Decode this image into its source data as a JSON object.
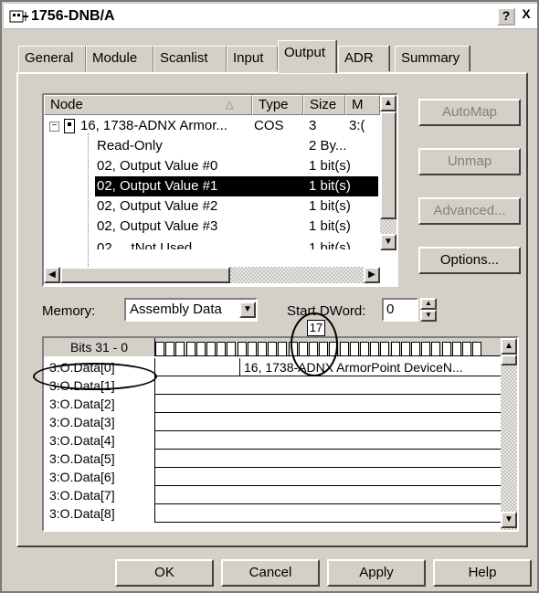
{
  "window": {
    "title": "1756-DNB/A",
    "help_label": "?",
    "close_label": "X"
  },
  "tabs": [
    {
      "label": "General"
    },
    {
      "label": "Module"
    },
    {
      "label": "Scanlist"
    },
    {
      "label": "Input"
    },
    {
      "label": "Output",
      "active": true
    },
    {
      "label": "ADR"
    },
    {
      "label": "Summary"
    }
  ],
  "tree": {
    "columns": {
      "node": "Node",
      "type": "Type",
      "size": "Size",
      "map": "M"
    },
    "rows": [
      {
        "node": "16, 1738-ADNX Armor...",
        "type": "COS",
        "size": "3",
        "map": "3:("
      },
      {
        "node": "Read-Only",
        "type": "",
        "size": "2 By...",
        "map": ""
      },
      {
        "node": "02, Output Value #0",
        "type": "",
        "size": "1 bit(s)",
        "map": ""
      },
      {
        "node": "02, Output Value #1",
        "type": "",
        "size": "1 bit(s)",
        "map": "",
        "selected": true
      },
      {
        "node": "02, Output Value #2",
        "type": "",
        "size": "1 bit(s)",
        "map": ""
      },
      {
        "node": "02, Output Value #3",
        "type": "",
        "size": "1 bit(s)",
        "map": ""
      }
    ],
    "partial_row": {
      "node": "02, ...tNot Used",
      "size": "1 bit(s)"
    }
  },
  "side_buttons": {
    "automap": "AutoMap",
    "unmap": "Unmap",
    "advanced": "Advanced...",
    "options": "Options..."
  },
  "memory": {
    "label": "Memory:",
    "value": "Assembly Data"
  },
  "start_dword": {
    "label": "Start DWord:",
    "value": "0"
  },
  "bit_indicator": "17",
  "grid": {
    "header_label": "Bits 31 - 0",
    "rows": [
      {
        "label": "3:O.Data[0]",
        "value": "16, 1738-ADNX ArmorPoint DeviceN..."
      },
      {
        "label": "3:O.Data[1]",
        "value": ""
      },
      {
        "label": "3:O.Data[2]",
        "value": ""
      },
      {
        "label": "3:O.Data[3]",
        "value": ""
      },
      {
        "label": "3:O.Data[4]",
        "value": ""
      },
      {
        "label": "3:O.Data[5]",
        "value": ""
      },
      {
        "label": "3:O.Data[6]",
        "value": ""
      },
      {
        "label": "3:O.Data[7]",
        "value": ""
      },
      {
        "label": "3:O.Data[8]",
        "value": ""
      }
    ]
  },
  "buttons": {
    "ok": "OK",
    "cancel": "Cancel",
    "apply": "Apply",
    "help": "Help"
  }
}
